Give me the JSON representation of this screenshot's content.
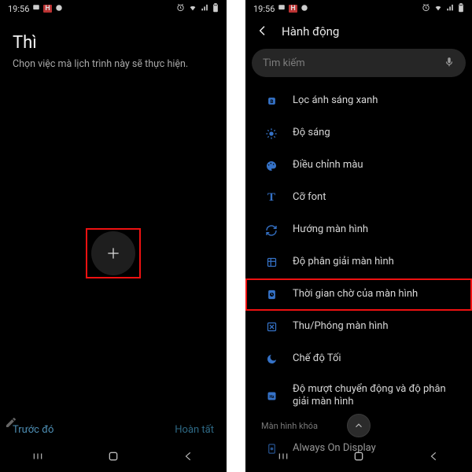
{
  "status": {
    "time": "19:56",
    "badge": "H"
  },
  "left": {
    "title": "Thì",
    "subtitle": "Chọn việc mà lịch trình này sẽ thực hiện.",
    "prev": "Trước đó",
    "done": "Hoàn tất"
  },
  "right": {
    "title": "Hành động",
    "search_placeholder": "Tìm kiếm",
    "items": [
      {
        "label": "Lọc ánh sáng xanh",
        "icon": "B"
      },
      {
        "label": "Độ sáng",
        "icon": "brightness"
      },
      {
        "label": "Điều chỉnh màu",
        "icon": "palette"
      },
      {
        "label": "Cỡ font",
        "icon": "T"
      },
      {
        "label": "Hướng màn hình",
        "icon": "rotate"
      },
      {
        "label": "Độ phân giải màn hình",
        "icon": "resolution"
      },
      {
        "label": "Thời gian chờ của màn hình",
        "icon": "timer",
        "highlight": true
      },
      {
        "label": "Thu/Phóng màn hình",
        "icon": "zoom"
      },
      {
        "label": "Chế độ Tối",
        "icon": "moon"
      },
      {
        "label": "Độ mượt chuyển động và độ phân giải màn hình",
        "icon": "hz",
        "tall": true
      }
    ],
    "section_label": "Màn hình khóa",
    "aod_label": "Always On Display"
  }
}
